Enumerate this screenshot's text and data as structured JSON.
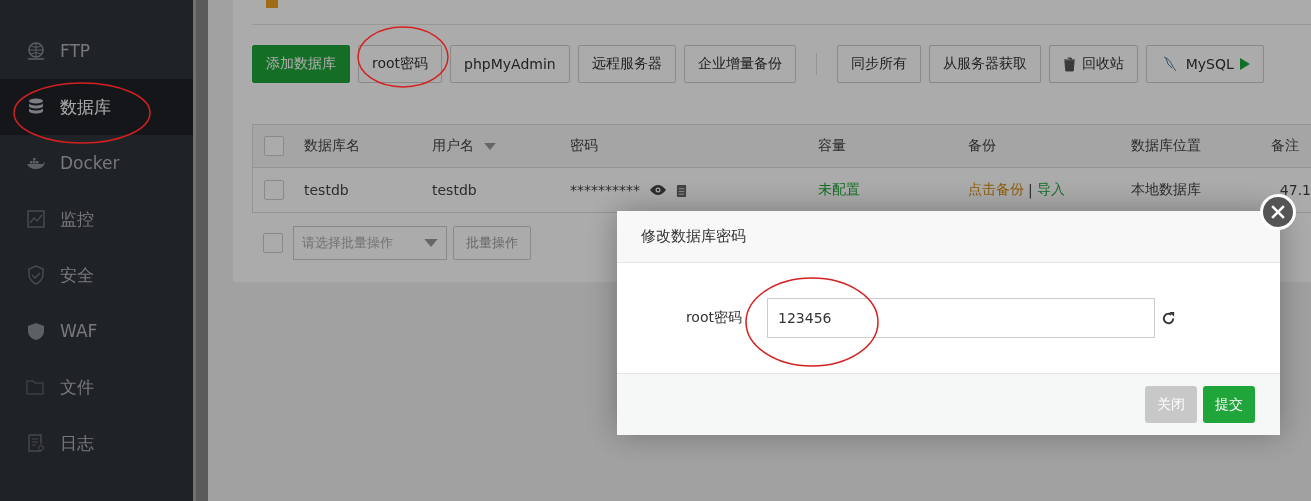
{
  "sidebar": {
    "items": [
      {
        "label": "FTP",
        "kind": "ftp",
        "selected": false
      },
      {
        "label": "数据库",
        "kind": "database",
        "selected": true
      },
      {
        "label": "Docker",
        "kind": "docker",
        "selected": false
      },
      {
        "label": "监控",
        "kind": "monitor",
        "selected": false
      },
      {
        "label": "安全",
        "kind": "security",
        "selected": false
      },
      {
        "label": "WAF",
        "kind": "waf",
        "selected": false
      },
      {
        "label": "文件",
        "kind": "files",
        "selected": false
      },
      {
        "label": "日志",
        "kind": "logs",
        "selected": false
      }
    ]
  },
  "toolbar": {
    "buttons": [
      {
        "label": "添加数据库",
        "kind": "primary"
      },
      {
        "label": "root密码",
        "kind": "default"
      },
      {
        "label": "phpMyAdmin",
        "kind": "default"
      },
      {
        "label": "远程服务器",
        "kind": "default"
      },
      {
        "label": "企业增量备份",
        "kind": "default"
      },
      {
        "label": "同步所有",
        "kind": "default",
        "group_start": true
      },
      {
        "label": "从服务器获取",
        "kind": "default"
      },
      {
        "label": "回收站",
        "kind": "trash"
      },
      {
        "label": "MySQL",
        "kind": "mysql"
      }
    ]
  },
  "table": {
    "header_checked": false,
    "columns": [
      {
        "label": "数据库名"
      },
      {
        "label": "用户名",
        "sortable": true
      },
      {
        "label": "密码"
      },
      {
        "label": "容量"
      },
      {
        "label": "备份"
      },
      {
        "label": "数据库位置"
      },
      {
        "label": "备注"
      }
    ],
    "rows": [
      {
        "checked": false,
        "name": "testdb",
        "user": "testdb",
        "password": "**********",
        "capacity": "未配置",
        "backup": "点击备份",
        "separator": "|",
        "import": "导入",
        "location": "本地数据库",
        "note": "47.1"
      }
    ]
  },
  "batch": {
    "checked": false,
    "select_placeholder": "请选择批量操作",
    "button": "批量操作"
  },
  "dialog": {
    "title": "修改数据库密码",
    "field_label": "root密码",
    "field_value": "123456",
    "buttons": [
      {
        "label": "关闭",
        "kind": "close"
      },
      {
        "label": "提交",
        "kind": "submit"
      }
    ]
  }
}
